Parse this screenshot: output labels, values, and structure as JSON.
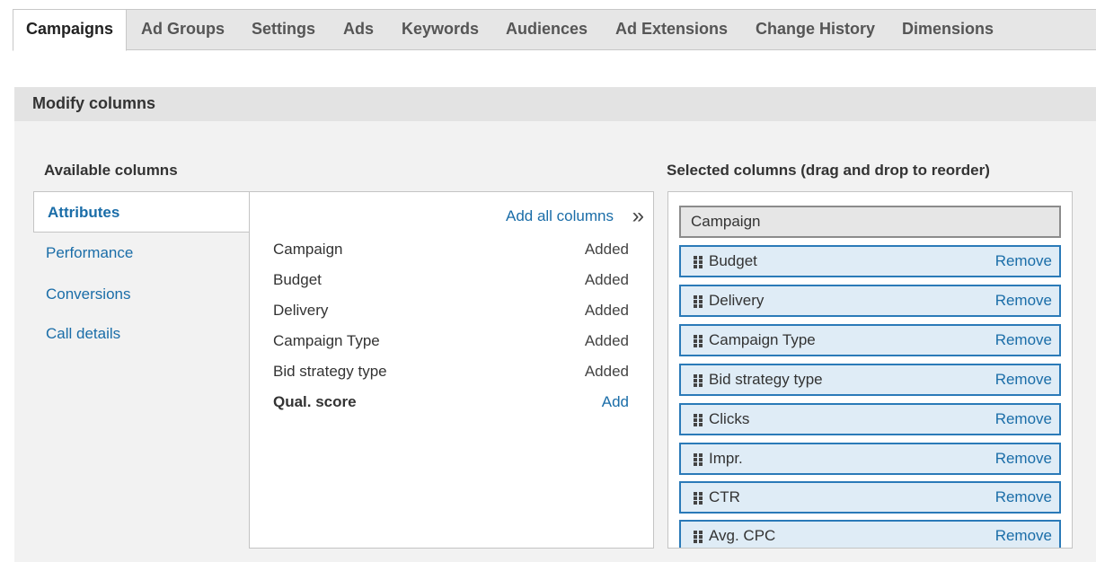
{
  "tabs": [
    {
      "label": "Campaigns",
      "active": true
    },
    {
      "label": "Ad Groups"
    },
    {
      "label": "Settings"
    },
    {
      "label": "Ads"
    },
    {
      "label": "Keywords"
    },
    {
      "label": "Audiences"
    },
    {
      "label": "Ad Extensions"
    },
    {
      "label": "Change History"
    },
    {
      "label": "Dimensions"
    }
  ],
  "panel": {
    "title": "Modify columns",
    "available_label": "Available columns",
    "selected_label": "Selected columns (drag and drop to reorder)"
  },
  "categories": [
    {
      "label": "Attributes",
      "active": true
    },
    {
      "label": "Performance"
    },
    {
      "label": "Conversions"
    },
    {
      "label": "Call details"
    }
  ],
  "available": {
    "add_all_label": "Add all columns",
    "chevron_glyph": "»",
    "rows": [
      {
        "name": "Campaign",
        "status": "Added"
      },
      {
        "name": "Budget",
        "status": "Added"
      },
      {
        "name": "Delivery",
        "status": "Added"
      },
      {
        "name": "Campaign Type",
        "status": "Added"
      },
      {
        "name": "Bid strategy type",
        "status": "Added"
      },
      {
        "name": "Qual. score",
        "status": "Add"
      }
    ]
  },
  "selected": {
    "fixed": "Campaign",
    "remove_label": "Remove",
    "items": [
      "Budget",
      "Delivery",
      "Campaign Type",
      "Bid strategy type",
      "Clicks",
      "Impr.",
      "CTR",
      "Avg. CPC"
    ]
  },
  "colors": {
    "link": "#1a6da8",
    "selected_bg": "#dfecf6",
    "selected_border": "#2a7ab8"
  }
}
